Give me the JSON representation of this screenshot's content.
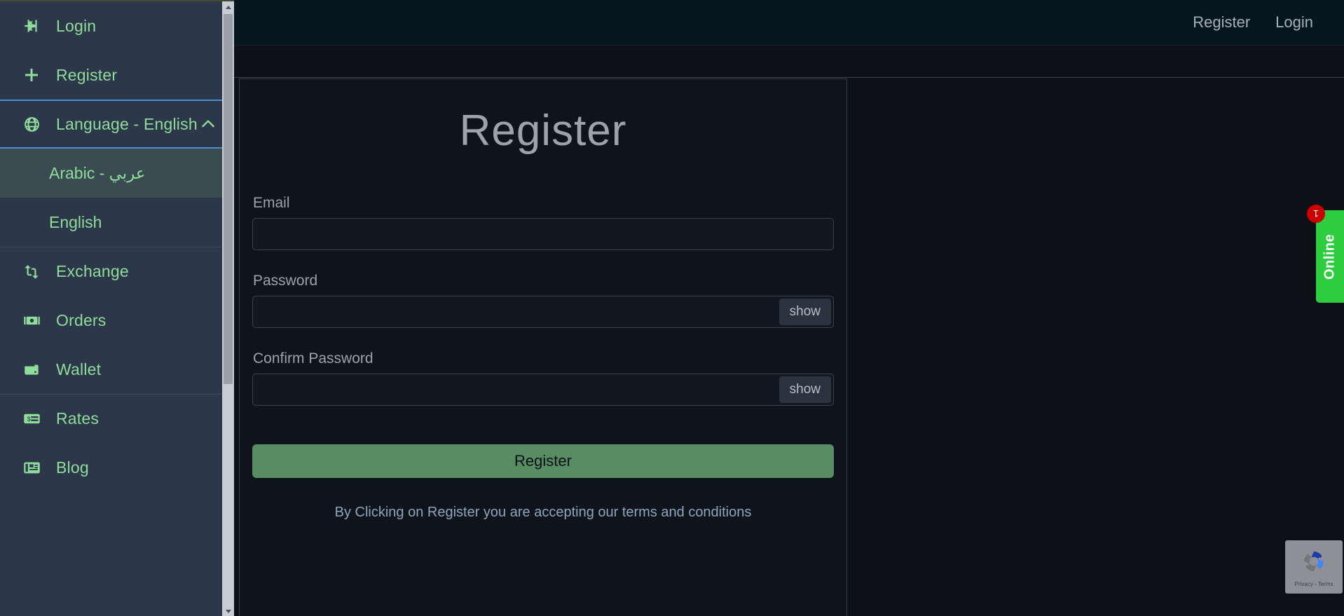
{
  "sidebar": {
    "items": [
      {
        "label": "Login",
        "icon": "login-arrow-icon"
      },
      {
        "label": "Register",
        "icon": "plus-icon"
      },
      {
        "label": "Language - English",
        "icon": "globe-icon",
        "chevron": "chevron-up-icon",
        "expanded": true
      },
      {
        "label": "Exchange",
        "icon": "exchange-arrows-icon"
      },
      {
        "label": "Orders",
        "icon": "banknote-icon"
      },
      {
        "label": "Wallet",
        "icon": "wallet-icon"
      },
      {
        "label": "Rates",
        "icon": "price-tag-icon"
      },
      {
        "label": "Blog",
        "icon": "newspaper-icon"
      }
    ],
    "language_options": [
      {
        "label": "Arabic - عربي",
        "hovered": true
      },
      {
        "label": "English",
        "hovered": false
      }
    ],
    "scrollbar": {
      "up_arrow": "scroll-up-arrow-icon",
      "down_arrow": "scroll-down-arrow-icon"
    }
  },
  "topbar": {
    "register_link": "Register",
    "login_link": "Login"
  },
  "register_form": {
    "title": "Register",
    "email": {
      "label": "Email",
      "value": "",
      "placeholder": ""
    },
    "password": {
      "label": "Password",
      "value": "",
      "placeholder": "",
      "toggle_label": "show"
    },
    "confirm_password": {
      "label": "Confirm Password",
      "value": "",
      "placeholder": "",
      "toggle_label": "show"
    },
    "submit_label": "Register",
    "terms_note": "By Clicking on Register you are accepting our terms and conditions"
  },
  "chat_widget": {
    "label": "Online",
    "badge_count": "1",
    "color": "#2ecc40"
  },
  "recaptcha": {
    "text": "Privacy - Terms",
    "icon": "recaptcha-logo-icon"
  },
  "colors": {
    "sidebar_bg": "#2c3749",
    "sidebar_accent": "#8fdc9b",
    "highlight_border": "#4a8fd4",
    "page_bg": "#0d1117",
    "topbar_bg": "#06161f",
    "submit_green": "#588c63",
    "badge_red": "#cc0000"
  }
}
